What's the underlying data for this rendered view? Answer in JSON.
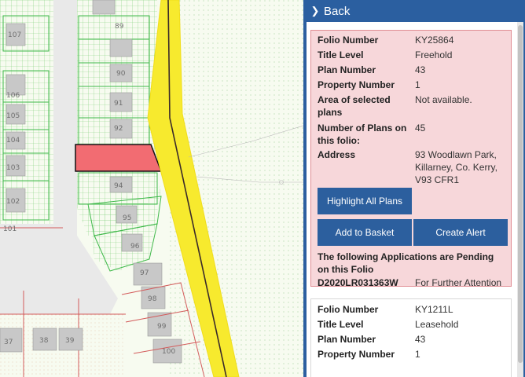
{
  "map": {
    "plot_labels": [
      "107",
      "106",
      "105",
      "104",
      "103",
      "102",
      "101",
      "89",
      "90",
      "91",
      "92",
      "94",
      "95",
      "96",
      "97",
      "98",
      "99",
      "100",
      "37",
      "38",
      "39"
    ]
  },
  "panel": {
    "back_label": "Back",
    "folios": [
      {
        "rows": [
          {
            "label": "Folio Number",
            "value": "KY25864"
          },
          {
            "label": "Title Level",
            "value": "Freehold"
          },
          {
            "label": "Plan Number",
            "value": "43"
          },
          {
            "label": "Property Number",
            "value": "1"
          },
          {
            "label": "Area of selected plans",
            "value": "Not available."
          },
          {
            "label": "Number of Plans on this folio:",
            "value": "45"
          },
          {
            "label": "Address",
            "value": "93 Woodlawn Park, Killarney, Co. Kerry, V93 CFR1"
          }
        ],
        "buttons": {
          "highlight_all": "Highlight All Plans",
          "add_to_basket": "Add to Basket",
          "create_alert": "Create Alert"
        },
        "pending_title": "The following Applications are Pending on this Folio",
        "pending": [
          {
            "number": "D2020LR031363W",
            "status": "For Further Attention"
          }
        ]
      },
      {
        "rows": [
          {
            "label": "Folio Number",
            "value": "KY1211L"
          },
          {
            "label": "Title Level",
            "value": "Leasehold"
          },
          {
            "label": "Plan Number",
            "value": "43"
          },
          {
            "label": "Property Number",
            "value": "1"
          }
        ]
      }
    ]
  },
  "colors": {
    "panel_blue": "#2b5fa0",
    "selected_plot": "#f26c72",
    "selected_card": "#f7d7da",
    "road_yellow": "#f7ea2e",
    "plan_green": "#55c255"
  }
}
